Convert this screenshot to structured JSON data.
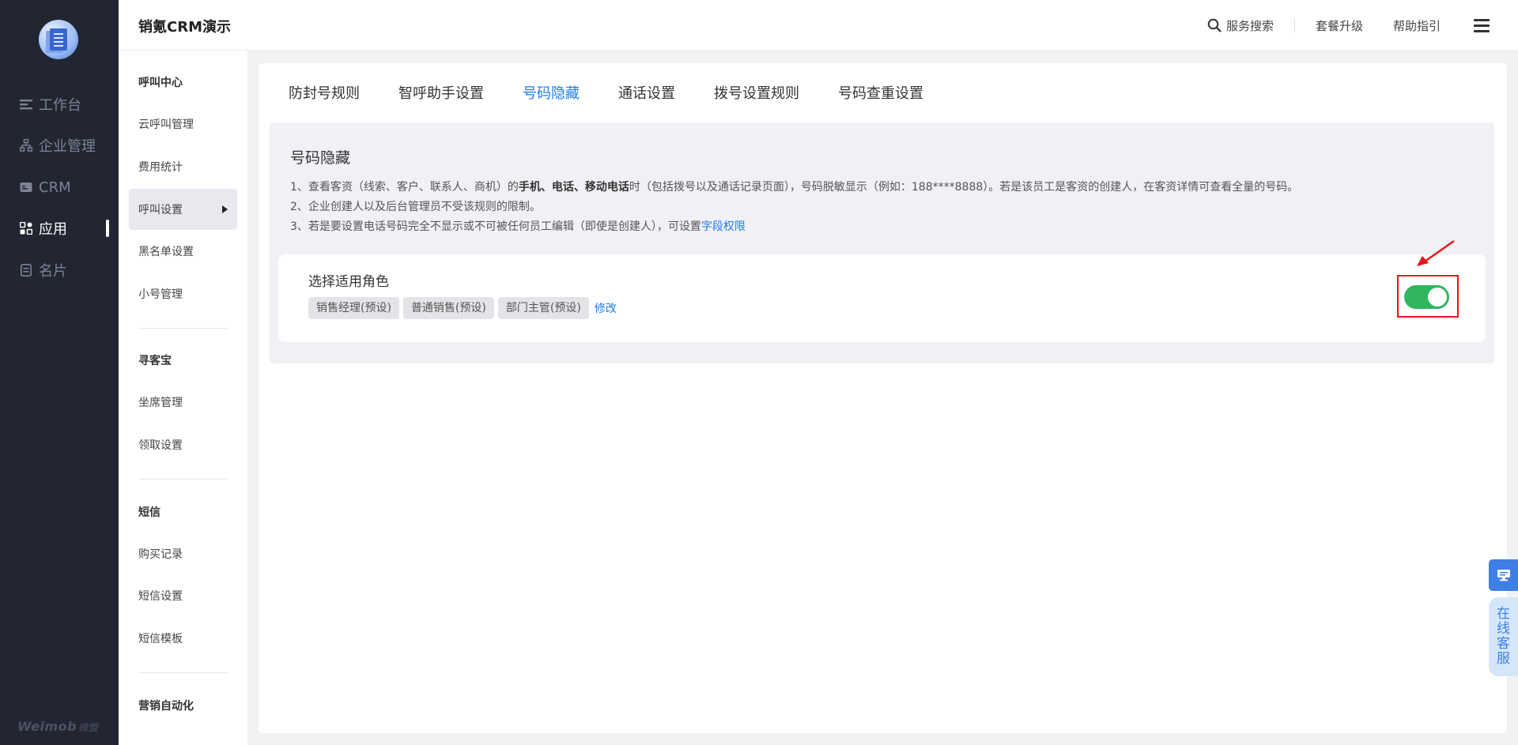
{
  "app": {
    "title": "销氪CRM演示"
  },
  "left_nav": {
    "items": [
      {
        "label": "工作台",
        "icon": "workbench-icon"
      },
      {
        "label": "企业管理",
        "icon": "org-tree-icon"
      },
      {
        "label": "CRM",
        "icon": "crm-card-icon"
      },
      {
        "label": "应用",
        "icon": "apps-grid-icon",
        "active": true
      },
      {
        "label": "名片",
        "icon": "business-card-icon"
      }
    ],
    "footer_brand": "Weimob",
    "footer_brand_cn": "微盟"
  },
  "header": {
    "search_label": "服务搜索",
    "upgrade_label": "套餐升级",
    "help_label": "帮助指引"
  },
  "sub_nav": {
    "groups": [
      {
        "title": "呼叫中心",
        "items": [
          "云呼叫管理",
          "费用统计",
          "呼叫设置",
          "黑名单设置",
          "小号管理"
        ]
      },
      {
        "title": "寻客宝",
        "items": [
          "坐席管理",
          "领取设置"
        ]
      },
      {
        "title": "短信",
        "items": [
          "购买记录",
          "短信设置",
          "短信模板"
        ]
      },
      {
        "title": "营销自动化",
        "items": []
      }
    ],
    "active_item": "呼叫设置"
  },
  "tabs": [
    {
      "label": "防封号规则"
    },
    {
      "label": "智呼助手设置"
    },
    {
      "label": "号码隐藏",
      "active": true
    },
    {
      "label": "通话设置"
    },
    {
      "label": "拨号设置规则"
    },
    {
      "label": "号码查重设置"
    }
  ],
  "section": {
    "title": "号码隐藏",
    "rule1_a": "1、查看客资（线索、客户、联系人、商机）的",
    "rule1_bold": "手机、电话、移动电话",
    "rule1_b": "时（包括拨号以及通话记录页面），号码脱敏显示（例如：188****8888）。若是该员工是客资的创建人，在客资详情可查看全量的号码。",
    "rule2": "2、企业创建人以及后台管理员不受该规则的限制。",
    "rule3_a": "3、若是要设置电话号码完全不显示或不可被任何员工编辑（即使是创建人），可设置",
    "rule3_link": "字段权限",
    "card": {
      "title": "选择适用角色",
      "roles": [
        "销售经理(预设)",
        "普通销售(预设)",
        "部门主管(预设)"
      ],
      "edit_label": "修改",
      "toggle_on": true
    }
  },
  "floating": {
    "service_label": "在线客服"
  },
  "colors": {
    "nav_bg": "#222633",
    "accent": "#1e7de6",
    "toggle_on": "#2fb65e",
    "highlight_border": "#e8161a"
  }
}
